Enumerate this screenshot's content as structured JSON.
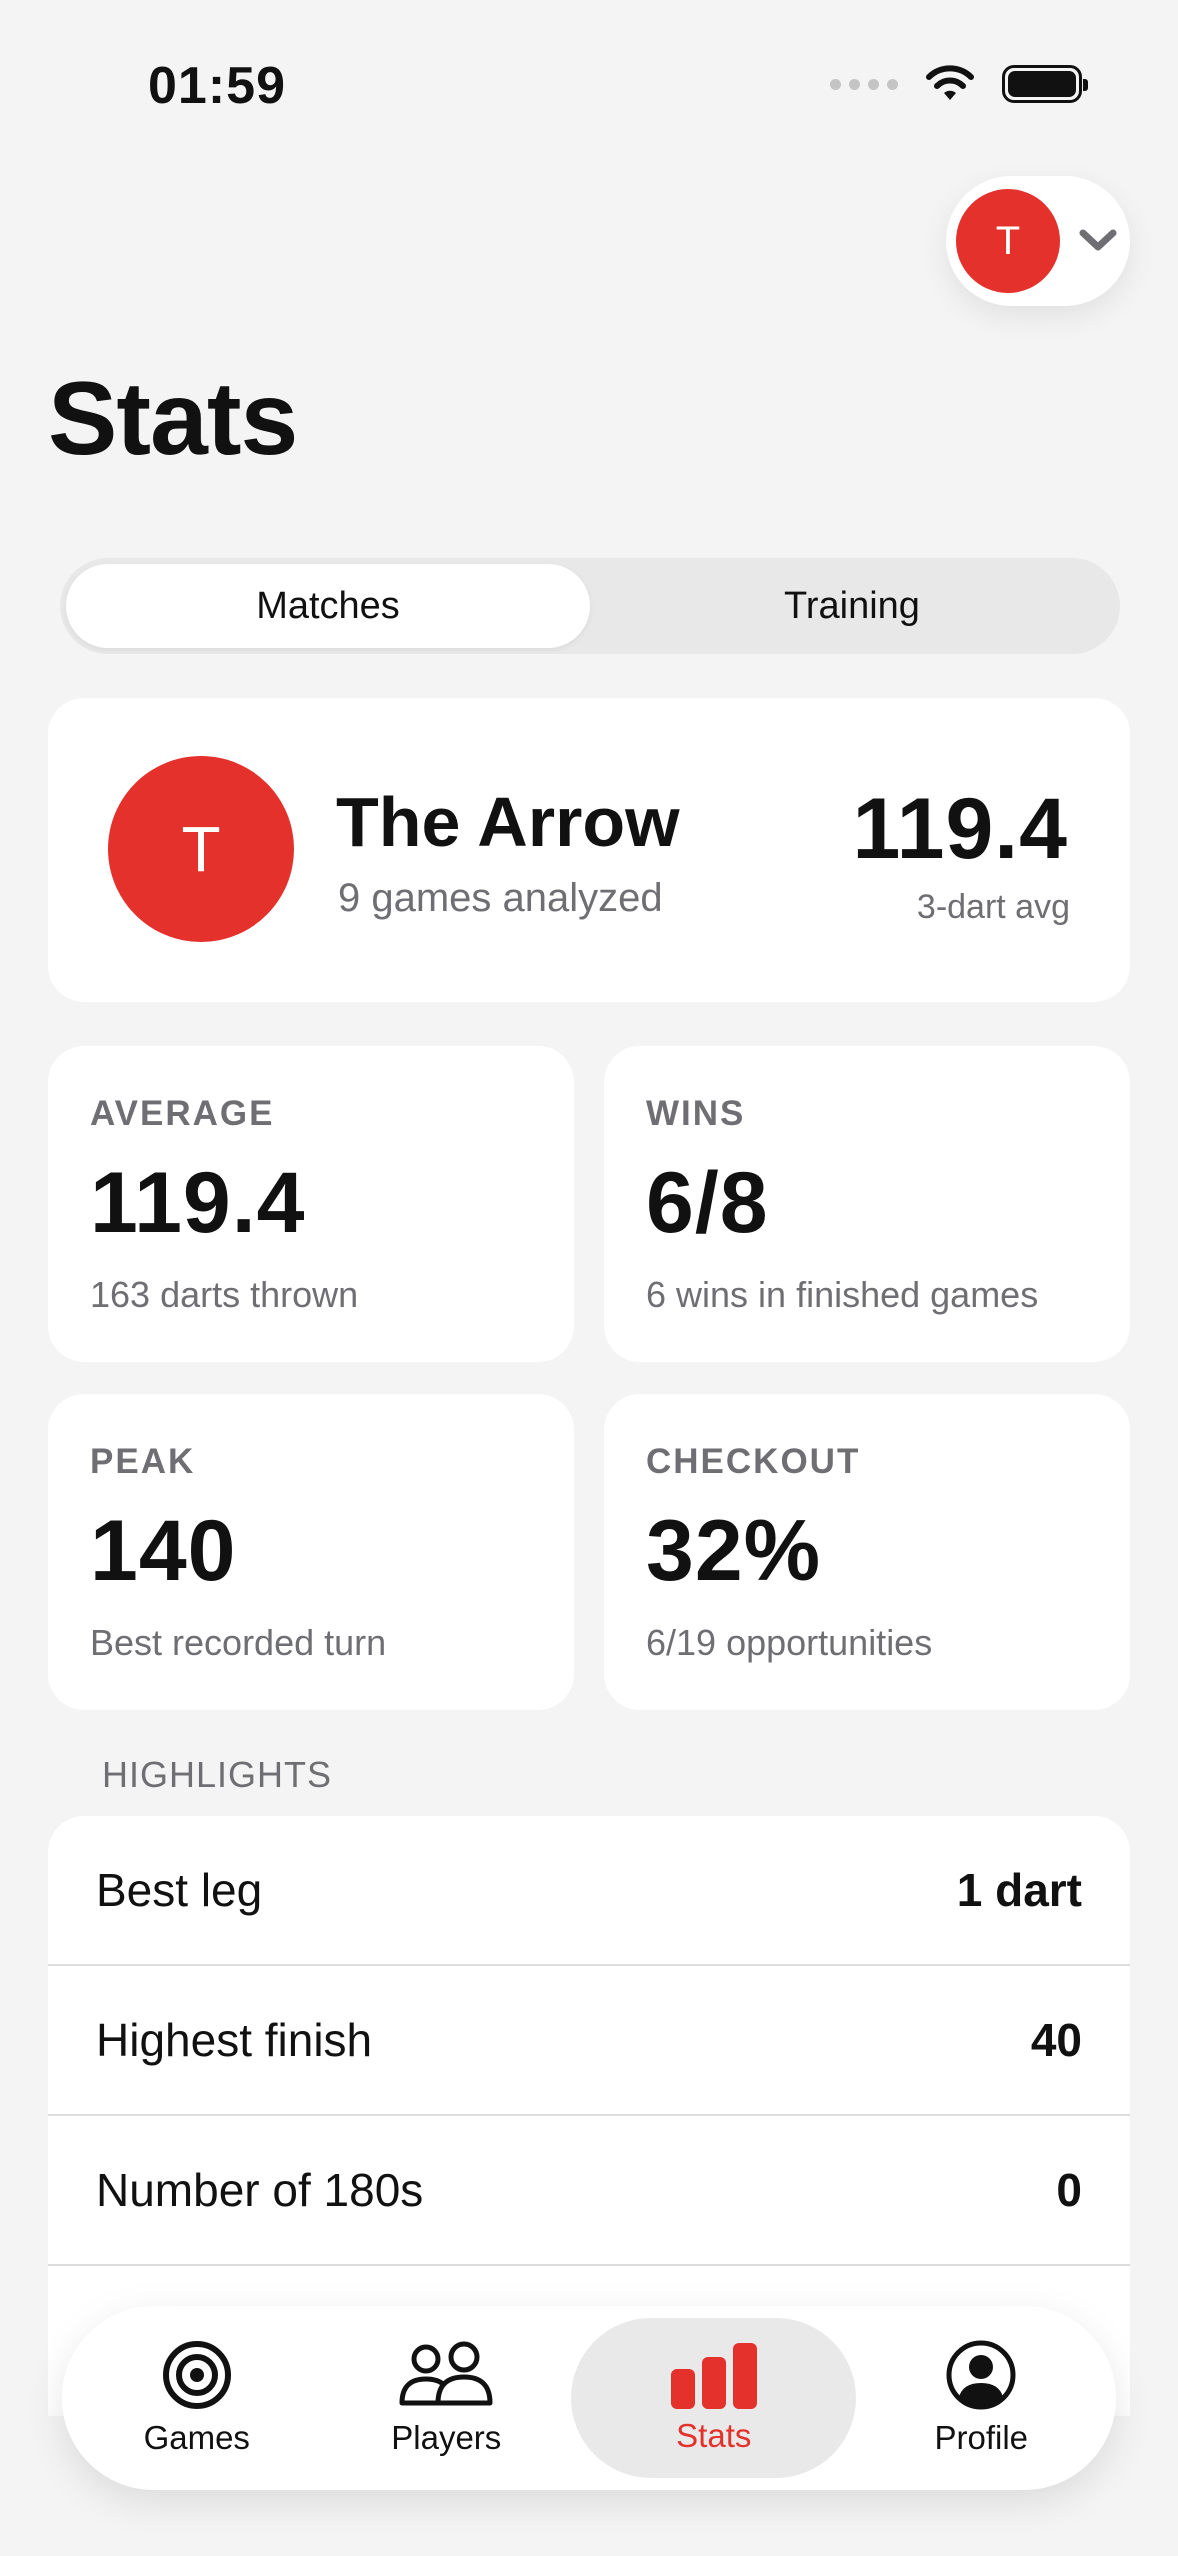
{
  "status_bar": {
    "time": "01:59"
  },
  "account": {
    "initial": "T"
  },
  "page": {
    "title": "Stats"
  },
  "segments": [
    {
      "label": "Matches",
      "selected": true
    },
    {
      "label": "Training",
      "selected": false
    }
  ],
  "profile": {
    "initial": "T",
    "name": "The Arrow",
    "subtitle": "9 games analyzed",
    "average": "119.4",
    "average_label": "3-dart avg"
  },
  "stats": {
    "average": {
      "label": "AVERAGE",
      "value": "119.4",
      "sub": "163 darts thrown"
    },
    "wins": {
      "label": "WINS",
      "value": "6/8",
      "sub": "6 wins in finished games"
    },
    "peak": {
      "label": "PEAK",
      "value": "140",
      "sub": "Best recorded turn"
    },
    "checkout": {
      "label": "CHECKOUT",
      "value": "32%",
      "sub": "6/19 opportunities"
    }
  },
  "highlights": {
    "header": "HIGHLIGHTS",
    "rows": [
      {
        "label": "Best leg",
        "value": "1 dart"
      },
      {
        "label": "Highest finish",
        "value": "40"
      },
      {
        "label": "Number of 180s",
        "value": "0"
      }
    ]
  },
  "tab_bar": {
    "items": [
      {
        "label": "Games",
        "icon": "target-icon"
      },
      {
        "label": "Players",
        "icon": "players-icon"
      },
      {
        "label": "Stats",
        "icon": "bar-chart-icon",
        "active": true
      },
      {
        "label": "Profile",
        "icon": "profile-icon"
      }
    ]
  },
  "colors": {
    "accent": "#e4312b",
    "background": "#f4f4f4",
    "card": "#ffffff",
    "muted_text": "#6e6e73"
  }
}
